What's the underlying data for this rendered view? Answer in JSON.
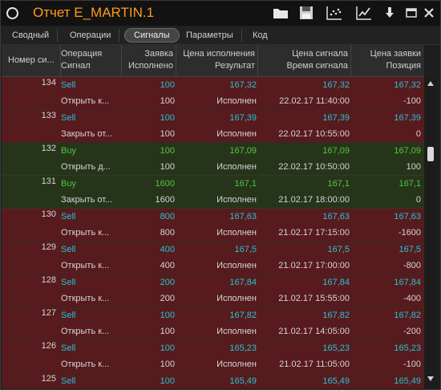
{
  "window": {
    "title": "Отчет E_MARTIN.1"
  },
  "tabs": [
    "Сводный",
    "Операции",
    "Сигналы",
    "Параметры",
    "Код"
  ],
  "active_tab": "Сигналы",
  "headers": {
    "num": [
      "Номер си..."
    ],
    "op": [
      "Операция",
      "Сигнал"
    ],
    "qty": [
      "Заявка",
      "Исполнено"
    ],
    "exec": [
      "Цена исполнения",
      "Результат"
    ],
    "sig": [
      "Цена сигнала",
      "Время сигнала"
    ],
    "ord": [
      "Цена заявки",
      "Позиция"
    ]
  },
  "colors": {
    "sell_bg": "#571b1d",
    "buy_bg": "#26351a",
    "sell_text": "#22c3d6",
    "buy_text": "#52c43f",
    "title": "#ff9a1e"
  },
  "signals": [
    {
      "num": "134",
      "kind": "sell",
      "op": "Sell",
      "qty": "100",
      "exec_price": "167,32",
      "sig_price": "167,32",
      "order_price": "167,32",
      "sub_op": "Открыть к...",
      "sub_qty": "100",
      "result": "Исполнен",
      "sig_time": "22.02.17 11:40:00",
      "position": "-100"
    },
    {
      "num": "133",
      "kind": "sell",
      "op": "Sell",
      "qty": "100",
      "exec_price": "167,39",
      "sig_price": "167,39",
      "order_price": "167,39",
      "sub_op": "Закрыть от...",
      "sub_qty": "100",
      "result": "Исполнен",
      "sig_time": "22.02.17 10:55:00",
      "position": "0"
    },
    {
      "num": "132",
      "kind": "buy",
      "op": "Buy",
      "qty": "100",
      "exec_price": "167,09",
      "sig_price": "167,09",
      "order_price": "167,09",
      "sub_op": "Открыть д...",
      "sub_qty": "100",
      "result": "Исполнен",
      "sig_time": "22.02.17 10:50:00",
      "position": "100"
    },
    {
      "num": "131",
      "kind": "buy",
      "op": "Buy",
      "qty": "1600",
      "exec_price": "167,1",
      "sig_price": "167,1",
      "order_price": "167,1",
      "sub_op": "Закрыть от...",
      "sub_qty": "1600",
      "result": "Исполнен",
      "sig_time": "21.02.17 18:00:00",
      "position": "0"
    },
    {
      "num": "130",
      "kind": "sell",
      "op": "Sell",
      "qty": "800",
      "exec_price": "167,63",
      "sig_price": "167,63",
      "order_price": "167,63",
      "sub_op": "Открыть к...",
      "sub_qty": "800",
      "result": "Исполнен",
      "sig_time": "21.02.17 17:15:00",
      "position": "-1600"
    },
    {
      "num": "129",
      "kind": "sell",
      "op": "Sell",
      "qty": "400",
      "exec_price": "167,5",
      "sig_price": "167,5",
      "order_price": "167,5",
      "sub_op": "Открыть к...",
      "sub_qty": "400",
      "result": "Исполнен",
      "sig_time": "21.02.17 17:00:00",
      "position": "-800"
    },
    {
      "num": "128",
      "kind": "sell",
      "op": "Sell",
      "qty": "200",
      "exec_price": "167,84",
      "sig_price": "167,84",
      "order_price": "167,84",
      "sub_op": "Открыть к...",
      "sub_qty": "200",
      "result": "Исполнен",
      "sig_time": "21.02.17 15:55:00",
      "position": "-400"
    },
    {
      "num": "127",
      "kind": "sell",
      "op": "Sell",
      "qty": "100",
      "exec_price": "167,82",
      "sig_price": "167,82",
      "order_price": "167,82",
      "sub_op": "Открыть к...",
      "sub_qty": "100",
      "result": "Исполнен",
      "sig_time": "21.02.17 14:05:00",
      "position": "-200"
    },
    {
      "num": "126",
      "kind": "sell",
      "op": "Sell",
      "qty": "100",
      "exec_price": "165,23",
      "sig_price": "165,23",
      "order_price": "165,23",
      "sub_op": "Открыть к...",
      "sub_qty": "100",
      "result": "Исполнен",
      "sig_time": "21.02.17 11:05:00",
      "position": "-100"
    },
    {
      "num": "125",
      "kind": "sell",
      "op": "Sell",
      "qty": "100",
      "exec_price": "165,49",
      "sig_price": "165,49",
      "order_price": "165,49",
      "sub_op": "",
      "sub_qty": "",
      "result": "",
      "sig_time": "",
      "position": ""
    }
  ]
}
